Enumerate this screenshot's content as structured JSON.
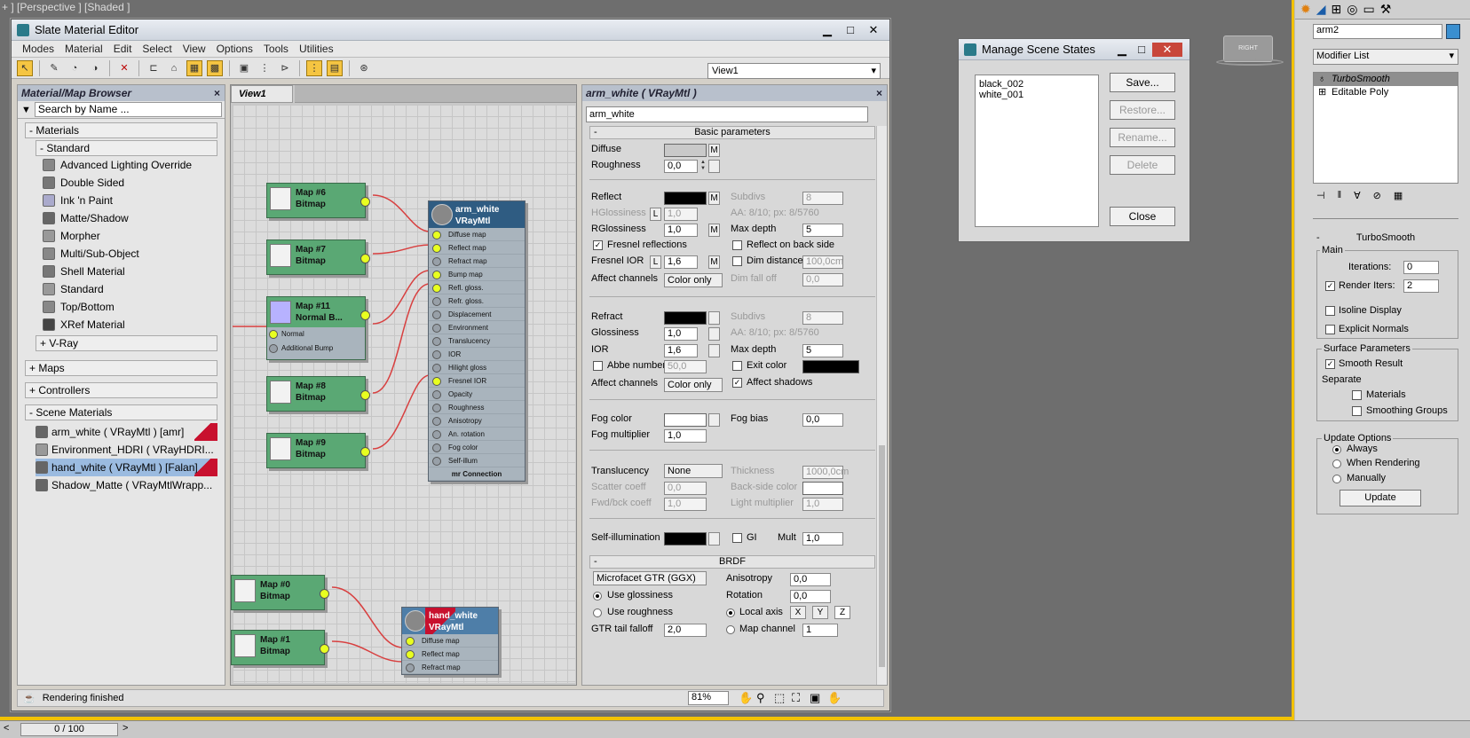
{
  "viewport": {
    "label": "+ ] [Perspective ] [Shaded ]",
    "cube_label": "RIGHT"
  },
  "slate": {
    "title": "Slate Material Editor",
    "menu": [
      "Modes",
      "Material",
      "Edit",
      "Select",
      "View",
      "Options",
      "Tools",
      "Utilities"
    ],
    "view_select": "View1",
    "browser": {
      "title": "Material/Map Browser",
      "search_placeholder": "Search by Name ...",
      "groups": {
        "materials": "- Materials",
        "standard": "- Standard",
        "vray": "+ V-Ray",
        "maps": "+ Maps",
        "controllers": "+ Controllers",
        "scene_materials": "- Scene Materials"
      },
      "standard_items": [
        "Advanced Lighting Override",
        "Double Sided",
        "Ink 'n Paint",
        "Matte/Shadow",
        "Morpher",
        "Multi/Sub-Object",
        "Shell Material",
        "Standard",
        "Top/Bottom",
        "XRef Material"
      ],
      "scene_items": [
        "arm_white  ( VRayMtl )  [amr]",
        "Environment_HDRI  ( VRayHDRI...",
        "hand_white  ( VRayMtl )  [Falan]",
        "Shadow_Matte  ( VRayMtlWrapp..."
      ]
    },
    "view_tab": "View1",
    "nodes": {
      "map6": [
        "Map #6",
        "Bitmap"
      ],
      "map7": [
        "Map #7",
        "Bitmap"
      ],
      "map11": [
        "Map #11",
        "Normal B..."
      ],
      "map11_slots": [
        "Normal",
        "Additional Bump"
      ],
      "map8": [
        "Map #8",
        "Bitmap"
      ],
      "map9": [
        "Map #9",
        "Bitmap"
      ],
      "map0": [
        "Map #0",
        "Bitmap"
      ],
      "map1": [
        "Map #1",
        "Bitmap"
      ],
      "arm": [
        "arm_white",
        "VRayMtl"
      ],
      "arm_slots": [
        "Diffuse map",
        "Reflect map",
        "Refract map",
        "Bump map",
        "Refl. gloss.",
        "Refr. gloss.",
        "Displacement",
        "Environment",
        "Translucency",
        "IOR",
        "Hilight gloss",
        "Fresnel IOR",
        "Opacity",
        "Roughness",
        "Anisotropy",
        "An. rotation",
        "Fog color",
        "Self-illum",
        "mr Connection"
      ],
      "hand": [
        "hand_white",
        "VRayMtl"
      ],
      "hand_slots": [
        "Diffuse map",
        "Reflect map",
        "Refract map"
      ]
    },
    "params": {
      "header": "arm_white  ( VRayMtl )",
      "name_field": "arm_white",
      "basic": "Basic parameters",
      "diffuse": "Diffuse",
      "roughness": "Roughness",
      "roughness_val": "0,0",
      "reflect": "Reflect",
      "subdivs": "Subdivs",
      "subdivs_val": "8",
      "hgloss": "HGlossiness",
      "hgloss_val": "1,0",
      "aa": "AA: 8/10; px: 8/5760",
      "rgloss": "RGlossiness",
      "rgloss_val": "1,0",
      "maxdepth": "Max depth",
      "maxdepth_val": "5",
      "fresnel": "Fresnel reflections",
      "backside": "Reflect on back side",
      "fresnel_ior": "Fresnel IOR",
      "fresnel_ior_val": "1,6",
      "dimdist": "Dim distance",
      "dimdist_val": "100,0cm",
      "affect_ch": "Affect channels",
      "coloronly": "Color only",
      "dimfall": "Dim fall off",
      "dimfall_val": "0,0",
      "refract": "Refract",
      "glossiness": "Glossiness",
      "gloss_val": "1,0",
      "ior": "IOR",
      "ior_val": "1,6",
      "abbe": "Abbe number",
      "abbe_val": "50,0",
      "exitcolor": "Exit color",
      "affect_shadows": "Affect shadows",
      "fogcolor": "Fog color",
      "fogbias": "Fog bias",
      "fogbias_val": "0,0",
      "fogmult": "Fog multiplier",
      "fogmult_val": "1,0",
      "translucency": "Translucency",
      "trans_val": "None",
      "thickness": "Thickness",
      "thickness_val": "1000,0cm",
      "scatter": "Scatter coeff",
      "scatter_val": "0,0",
      "backside_color": "Back-side color",
      "fwdbck": "Fwd/bck coeff",
      "fwdbck_val": "1,0",
      "lightmult": "Light multiplier",
      "lightmult_val": "1,0",
      "selfillum": "Self-illumination",
      "gi": "GI",
      "mult": "Mult",
      "mult_val": "1,0",
      "brdf": "BRDF",
      "brdf_type": "Microfacet GTR (GGX)",
      "anisotropy": "Anisotropy",
      "aniso_val": "0,0",
      "use_gloss": "Use glossiness",
      "rotation": "Rotation",
      "rot_val": "0,0",
      "use_rough": "Use roughness",
      "local_axis": "Local axis",
      "x": "X",
      "y": "Y",
      "z": "Z",
      "gtr": "GTR tail falloff",
      "gtr_val": "2,0",
      "mapch": "Map channel",
      "mapch_val": "1",
      "m": "M",
      "l": "L"
    },
    "status": "Rendering finished",
    "zoom": "81%"
  },
  "mss": {
    "title": "Manage Scene States",
    "states": [
      "black_002",
      "white_001"
    ],
    "buttons": {
      "save": "Save...",
      "restore": "Restore...",
      "rename": "Rename...",
      "delete": "Delete",
      "close": "Close"
    }
  },
  "cmd": {
    "object_name": "arm2",
    "modifier_list": "Modifier List",
    "stack": [
      "TurboSmooth",
      "Editable Poly"
    ],
    "rollout": "TurboSmooth",
    "main": "Main",
    "iterations": "Iterations:",
    "iterations_val": "0",
    "render_iters": "Render Iters:",
    "render_iters_val": "2",
    "isoline": "Isoline Display",
    "explicit": "Explicit Normals",
    "surface": "Surface Parameters",
    "smooth": "Smooth Result",
    "separate": "Separate",
    "materials": "Materials",
    "smoothing_groups": "Smoothing Groups",
    "update_opts": "Update Options",
    "always": "Always",
    "when_rendering": "When Rendering",
    "manually": "Manually",
    "update": "Update"
  },
  "timeline": {
    "frame": "0 / 100",
    "next": ">"
  }
}
